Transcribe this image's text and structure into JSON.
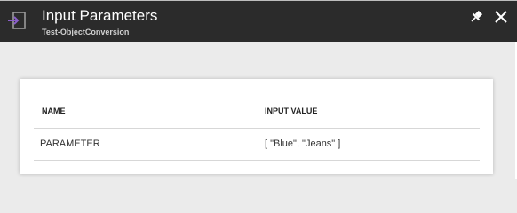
{
  "header": {
    "title": "Input Parameters",
    "subtitle": "Test-ObjectConversion",
    "icon": "input-parameters-icon",
    "accent_color": "#8a5ec9",
    "background_color": "#2b2b2b"
  },
  "table": {
    "columns": [
      "NAME",
      "INPUT VALUE"
    ],
    "rows": [
      {
        "name": "PARAMETER",
        "value": "[ \"Blue\", \"Jeans\" ]"
      }
    ]
  },
  "icons": {
    "pin": "pin-icon",
    "close": "close-icon"
  }
}
